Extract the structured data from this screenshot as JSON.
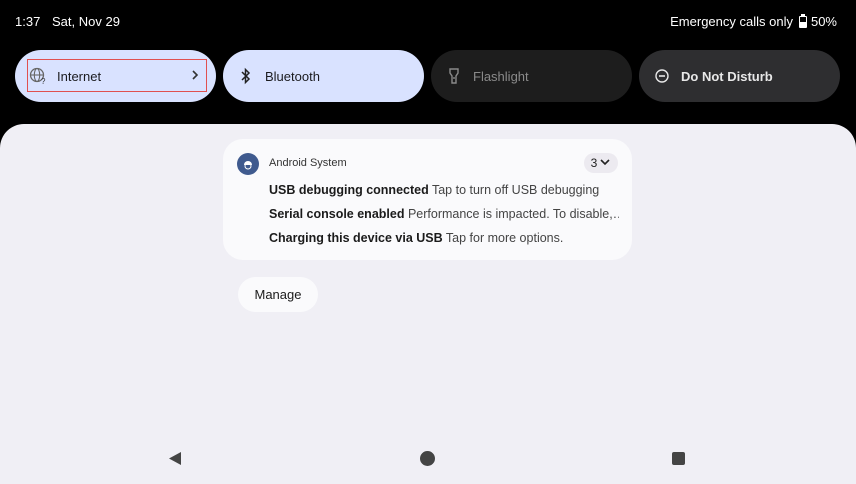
{
  "status_bar": {
    "time": "1:37",
    "date": "Sat, Nov 29",
    "carrier_text": "Emergency calls only",
    "battery": "50%"
  },
  "quick_settings": {
    "internet_label": "Internet",
    "bluetooth_label": "Bluetooth",
    "flashlight_label": "Flashlight",
    "dnd_label": "Do Not Disturb"
  },
  "notification": {
    "app_name": "Android System",
    "count": "3",
    "lines": [
      {
        "title": "USB debugging connected",
        "body": "Tap to turn off USB debugging"
      },
      {
        "title": "Serial console enabled",
        "body": "Performance is impacted. To disable,…"
      },
      {
        "title": "Charging this device via USB",
        "body": "Tap for more options."
      }
    ]
  },
  "manage_label": "Manage",
  "colors": {
    "tile_active": "#d9e2ff",
    "tile_inactive": "#1d1d1d",
    "shade_bg": "#f0eff5",
    "highlight": "#e05050"
  }
}
